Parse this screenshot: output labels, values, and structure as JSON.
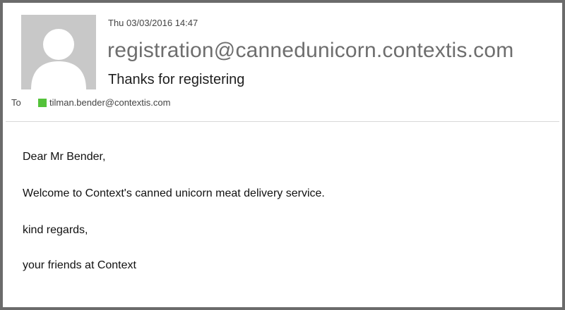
{
  "email": {
    "date": "Thu 03/03/2016 14:47",
    "sender": "registration@cannedunicorn.contextis.com",
    "subject": "Thanks for registering",
    "to_label": "To",
    "to_address": "tilman.bender@contextis.com",
    "presence_color": "#54c23a",
    "avatar_icon": "default-person-icon",
    "body": {
      "greeting": "Dear Mr Bender,",
      "line1": "Welcome to Context's canned unicorn meat delivery service.",
      "closing": "kind regards,",
      "signature": "your friends at Context"
    }
  }
}
